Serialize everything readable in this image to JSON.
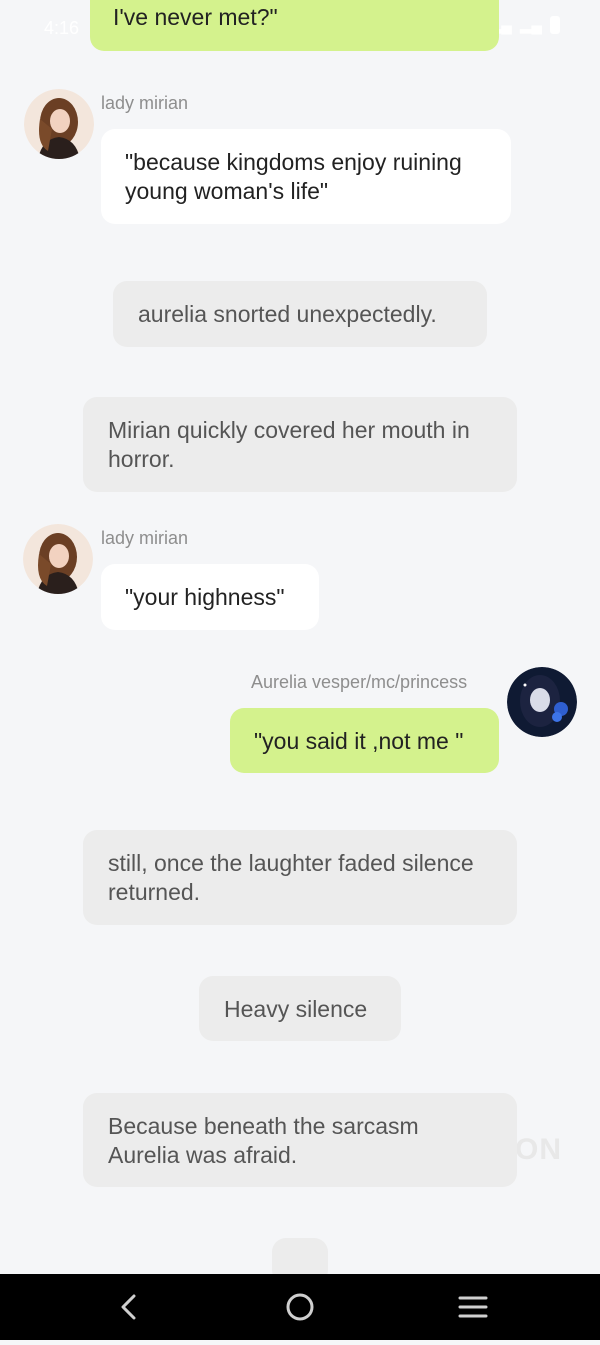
{
  "status_bar": {
    "time": "4:16",
    "icons": [
      "bluetooth-icon",
      "vibrate-icon",
      "call-icon",
      "volte-icon",
      "wifi-icon",
      "signal-icon",
      "signal-icon",
      "battery-icon"
    ]
  },
  "messages": {
    "m0": {
      "speaker": "",
      "text": "I've never met?\""
    },
    "m1": {
      "speaker": "lady mirian",
      "text": "\"because kingdoms enjoy ruining young woman's life\""
    },
    "m2": {
      "text": "aurelia snorted unexpectedly."
    },
    "m3": {
      "text": "Mirian quickly covered her mouth in horror."
    },
    "m4": {
      "speaker": "lady mirian",
      "text": "\"your highness\""
    },
    "m5": {
      "speaker": "Aurelia vesper/mc/princess",
      "text": "\"you said it ,not me \""
    },
    "m6": {
      "text": "still, once the laughter faded silence returned."
    },
    "m7": {
      "text": "Heavy silence"
    },
    "m8": {
      "text": "Because beneath the sarcasm Aurelia was afraid."
    }
  },
  "watermark": "ON",
  "colors": {
    "background": "#f5f6f8",
    "user_bubble": "#d4f28d",
    "npc_bubble": "#ffffff",
    "narration_bubble": "#ececec",
    "nav_bar": "#000000"
  },
  "nav": {
    "icons": [
      "back-icon",
      "home-icon",
      "recents-icon"
    ]
  }
}
